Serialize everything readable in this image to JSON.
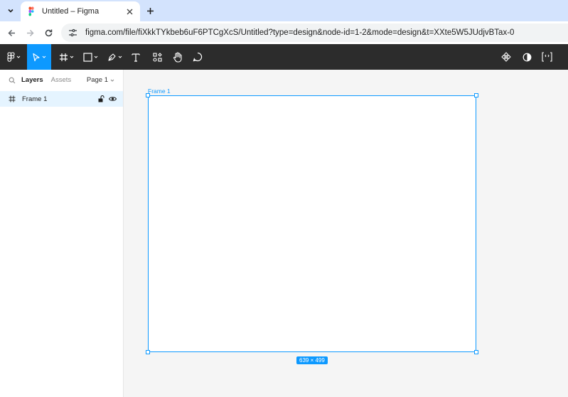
{
  "browser": {
    "tab_title": "Untitled – Figma",
    "url": "figma.com/file/fiXkkTYkbeb6uF6PTCgXcS/Untitled?type=design&node-id=1-2&mode=design&t=XXte5W5JUdjvBTax-0"
  },
  "panel": {
    "layers_label": "Layers",
    "assets_label": "Assets",
    "page_label": "Page 1"
  },
  "layers": [
    {
      "name": "Frame 1"
    }
  ],
  "canvas": {
    "frame_label": "Frame 1",
    "size_badge": "639 × 499"
  },
  "colors": {
    "accent": "#0d99ff",
    "toolbar_bg": "#2c2c2c",
    "tabstrip_bg": "#d3e3fd",
    "selection_row": "#e5f4ff"
  }
}
